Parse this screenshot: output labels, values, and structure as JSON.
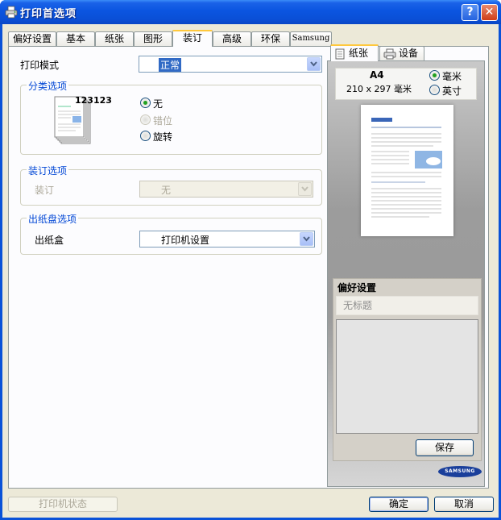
{
  "window": {
    "title": "打印首选项"
  },
  "tabs": [
    {
      "label": "偏好设置"
    },
    {
      "label": "基本"
    },
    {
      "label": "纸张"
    },
    {
      "label": "图形"
    },
    {
      "label": "装订"
    },
    {
      "label": "高级"
    },
    {
      "label": "环保"
    },
    {
      "label": "Samsung"
    }
  ],
  "print_mode": {
    "label": "打印模式",
    "value": "正常"
  },
  "collate": {
    "title": "分类选项",
    "sample_text": "123123",
    "options": [
      {
        "label": "无",
        "selected": true,
        "enabled": true
      },
      {
        "label": "错位",
        "selected": false,
        "enabled": false
      },
      {
        "label": "旋转",
        "selected": false,
        "enabled": true
      }
    ]
  },
  "binding": {
    "title": "装订选项",
    "label": "装订",
    "value": "无"
  },
  "output_tray": {
    "title": "出纸盘选项",
    "label": "出纸盒",
    "value": "打印机设置"
  },
  "preview": {
    "tabs": [
      {
        "label": "纸张"
      },
      {
        "label": "设备"
      }
    ],
    "paper_name": "A4",
    "paper_size": "210 x 297 毫米",
    "units": [
      {
        "label": "毫米",
        "selected": true
      },
      {
        "label": "英寸",
        "selected": false
      }
    ],
    "logo_text": "SAMSUNG"
  },
  "favorites": {
    "title": "偏好设置",
    "current": "无标题",
    "save_label": "保存"
  },
  "footer": {
    "printer_status": "打印机状态",
    "ok": "确定",
    "cancel": "取消"
  },
  "colors": {
    "title_bar": "#0b55e0",
    "group_title": "#0046d5",
    "face": "#ece9d8"
  }
}
